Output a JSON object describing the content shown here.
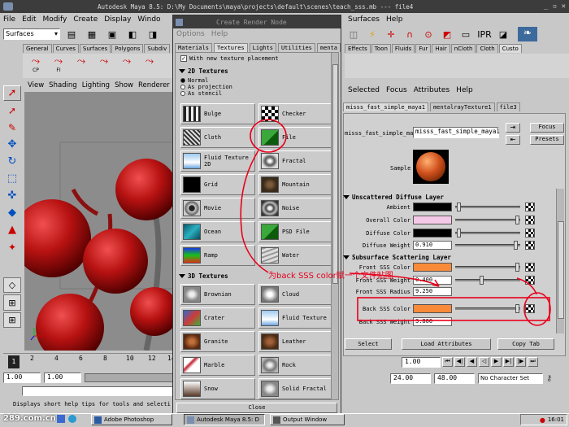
{
  "maya": {
    "title": "Autodesk Maya 8.5: D:\\My Documents\\maya\\projects\\default\\scenes\\teach_sss.mb  ---  file4",
    "menu": [
      "File",
      "Edit",
      "Modify",
      "Create",
      "Display",
      "Windo"
    ],
    "right_menu": [
      "Surfaces",
      "Help"
    ],
    "mode": "Surfaces",
    "shelf_tabs": [
      "General",
      "Curves",
      "Surfaces",
      "Polygons",
      "Subdiv"
    ],
    "right_shelf_tabs": [
      "Effects",
      "Toon",
      "Fluids",
      "Fur",
      "Hair",
      "nCloth",
      "Cloth",
      "Custo"
    ],
    "shelf_icons": [
      "CP",
      "FI"
    ],
    "panel_menu": [
      "View",
      "Shading",
      "Lighting",
      "Show",
      "Renderer"
    ],
    "time_ticks": [
      "2",
      "4",
      "6",
      "8",
      "10",
      "12",
      "14"
    ],
    "current_frame": "1",
    "range_start": "1.00",
    "range_start2": "1.00",
    "range_end": "24.00",
    "range_end2": "48.00",
    "frame_field": "1.00",
    "char_set": "No Character Set",
    "help_line": "Displays short help tips for tools and selecti"
  },
  "render_node": {
    "title": "Create Render Node",
    "menu": [
      "Options",
      "Help"
    ],
    "tabs": [
      "Materials",
      "Textures",
      "Lights",
      "Utilities",
      "menta"
    ],
    "active_tab": "Textures",
    "checkbox_label": "With new texture placement",
    "sec_2d": "2D Textures",
    "radio": [
      "Normal",
      "As projection",
      "As stencil"
    ],
    "textures_2d": [
      "Bulge",
      "Checker",
      "Cloth",
      "File",
      "Fluid Texture 2D",
      "Fractal",
      "Grid",
      "Mountain",
      "Movie",
      "Noise",
      "Ocean",
      "PSD File",
      "Ramp",
      "Water"
    ],
    "sec_3d": "3D Textures",
    "textures_3d": [
      "Brownian",
      "Cloud",
      "Crater",
      "Fluid Texture",
      "Granite",
      "Leather",
      "Marble",
      "Rock",
      "Snow",
      "Solid Fractal"
    ],
    "close": "Close"
  },
  "attr_editor": {
    "menu": [
      "Selected",
      "Focus",
      "Attributes",
      "Help"
    ],
    "tabs": [
      "misss_fast_simple_maya1",
      "mentalrayTexture1",
      "file3"
    ],
    "node_label": "misss_fast_simple_maya:",
    "node_name": "misss_fast_simple_maya1",
    "focus": "Focus",
    "presets": "Presets",
    "sample": "Sample",
    "sec_unscattered": "Unscattered Diffuse Layer",
    "ambient": "Ambient",
    "overall": "Overall Color",
    "diffuse": "Diffuse Color",
    "diffuse_weight": "Diffuse Weight",
    "diffuse_weight_val": "0.910",
    "sec_sss": "Subsurface Scattering Layer",
    "front_col": "Front SSS Color",
    "front_weight": "Front SSS Weight",
    "front_weight_val": "0.400",
    "front_radius": "Front SSS Radius",
    "front_radius_val": "9.250",
    "back_col": "Back SSS Color",
    "back_weight": "Back SSS Weight",
    "back_weight_val": "3.800",
    "select": "Select",
    "load": "Load Attributes",
    "copy": "Copy Tab"
  },
  "annotation": "为back SSS color赋一个文件贴图",
  "taskbar": {
    "watermark": "289.com.cn",
    "items": [
      "Adobe Photoshop",
      "Autodesk Maya 8.5: D",
      "Output Window"
    ],
    "clock": "16:01"
  },
  "colors": {
    "orange": "#f88a3a",
    "pink": "#f6c8e8",
    "red_annotation": "#e8001c",
    "sphere": "#c01818"
  }
}
